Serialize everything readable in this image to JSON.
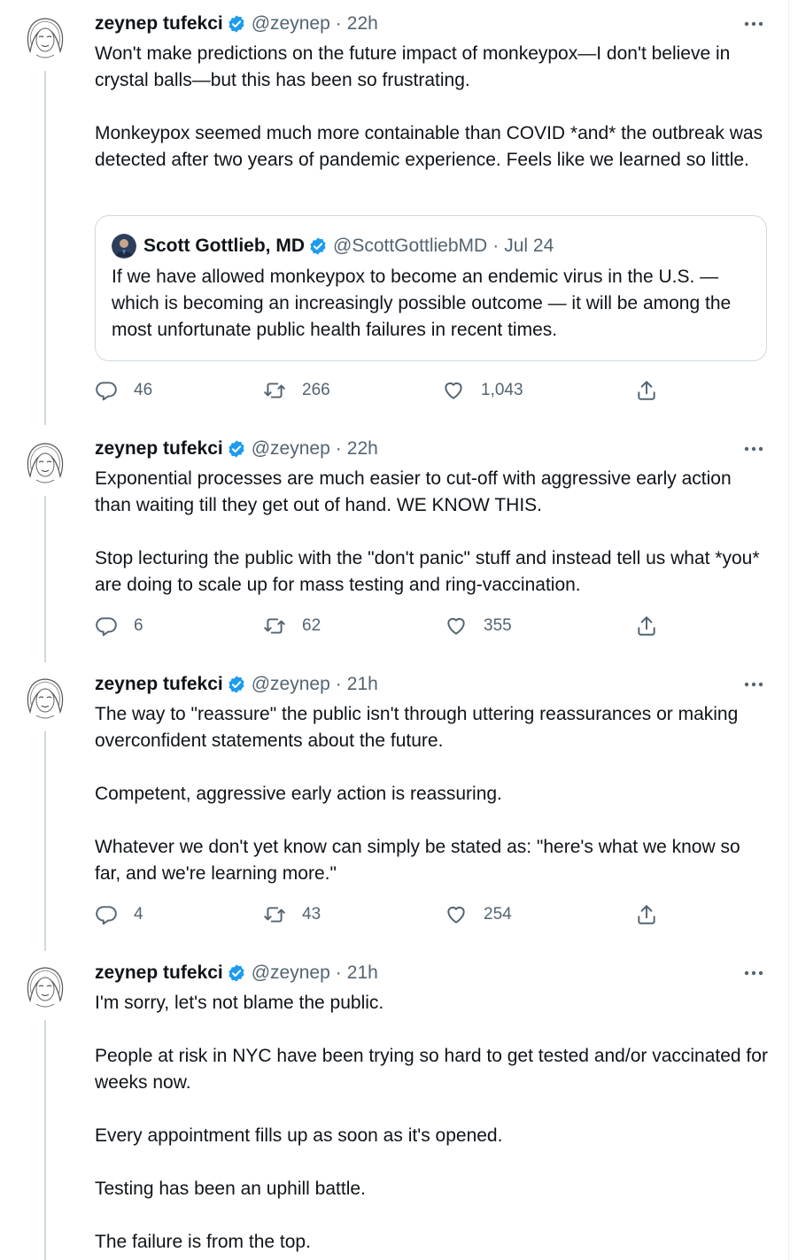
{
  "colors": {
    "accent": "#1d9bf0",
    "text": "#0f1419",
    "secondary": "#536471",
    "border": "#cfd9de"
  },
  "icons": {
    "verified": "verified-badge-icon",
    "more": "more-icon",
    "reply": "reply-icon",
    "retweet": "retweet-icon",
    "like": "heart-icon",
    "share": "share-icon"
  },
  "tweets": [
    {
      "name": "zeynep tufekci",
      "handle": "@zeynep",
      "separator": "·",
      "time": "22h",
      "paragraphs": [
        "Won't make predictions on the future impact of monkeypox—I don't believe in crystal balls—but this has been so frustrating.",
        "Monkeypox seemed much more containable than COVID *and* the outbreak was detected after two years of pandemic experience. Feels like we learned so little."
      ],
      "quote": {
        "name": "Scott Gottlieb, MD",
        "handle": "@ScottGottliebMD",
        "separator": "·",
        "time": "Jul 24",
        "text": "If we have allowed monkeypox to become an endemic virus in the U.S. — which is becoming an increasingly possible outcome — it will be among the most unfortunate public health failures in recent times."
      },
      "replies": "46",
      "retweets": "266",
      "likes": "1,043"
    },
    {
      "name": "zeynep tufekci",
      "handle": "@zeynep",
      "separator": "·",
      "time": "22h",
      "paragraphs": [
        "Exponential processes are much easier to cut-off with aggressive early action than waiting till they get out of hand. WE KNOW THIS.",
        "Stop lecturing the public with the \"don't panic\" stuff and instead tell us what *you* are doing to scale up for mass testing and ring-vaccination."
      ],
      "replies": "6",
      "retweets": "62",
      "likes": "355"
    },
    {
      "name": "zeynep tufekci",
      "handle": "@zeynep",
      "separator": "·",
      "time": "21h",
      "paragraphs": [
        "The way to \"reassure\" the public isn't through uttering reassurances or making overconfident statements about the future.",
        "Competent, aggressive early action is reassuring.",
        "Whatever we don't yet know can simply be stated as: \"here's what we know so far, and we're learning more.\""
      ],
      "replies": "4",
      "retweets": "43",
      "likes": "254"
    },
    {
      "name": "zeynep tufekci",
      "handle": "@zeynep",
      "separator": "·",
      "time": "21h",
      "paragraphs": [
        "I'm sorry, let's not blame the public.",
        "People at risk in NYC have been trying so hard to get tested and/or vaccinated for weeks now.",
        "Every appointment fills up as soon as it's opened.",
        "Testing has been an uphill battle.",
        "The failure is from the top."
      ]
    }
  ]
}
